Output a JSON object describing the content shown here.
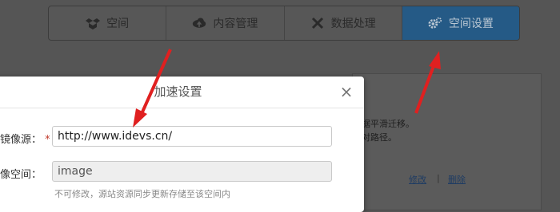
{
  "nav": {
    "tabs": [
      {
        "label": "空间",
        "icon": "dropbox-icon"
      },
      {
        "label": "内容管理",
        "icon": "cloud-upload-icon"
      },
      {
        "label": "数据处理",
        "icon": "tools-icon"
      },
      {
        "label": "空间设置",
        "icon": "gear-icon",
        "active": true
      }
    ]
  },
  "background": {
    "line1": "据平滑迁移。",
    "line2": "对路径。",
    "edit_link": "修改",
    "separator": "|",
    "delete_link": "删除"
  },
  "dialog": {
    "title": "加速设置",
    "close_glyph": "×",
    "mirror_source": {
      "label": "镜像源：",
      "required_mark": "*",
      "value": "http://www.idevs.cn/"
    },
    "mirror_space": {
      "label": "像空间：",
      "value": "image",
      "hint": "不可修改，源站资源同步更新存储至该空间内"
    }
  },
  "colors": {
    "active_tab": "#255a86",
    "annotation_arrow": "#e02020"
  }
}
